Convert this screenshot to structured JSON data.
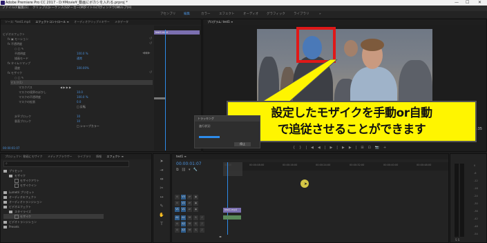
{
  "window": {
    "title": "Adobe Premiere Pro CC 2017 - D:¥Movie¥_動画にボカシを入れる.prproj *",
    "controls": [
      "—",
      "☐",
      "✕"
    ]
  },
  "menu": [
    "ファイル(F)",
    "編集(E)",
    "クリップ(C)",
    "シーケンス(S)",
    "マーカー(M)",
    "タイトル(T)",
    "ウィンドウ(W)",
    "ヘルプ(H)"
  ],
  "workspaces": {
    "items": [
      "アセンブリ",
      "編集",
      "カラー",
      "エフェクト",
      "オーディオ",
      "グラフィック",
      "ライブラリ"
    ],
    "active_index": 1,
    "more": "»"
  },
  "effect_controls": {
    "tabs": [
      "ソース: *test1.mp4",
      "エフェクトコントロール ≡",
      "オーディオクリップミキサー",
      "メタデータ"
    ],
    "clip_name": "test1.mp4",
    "rows": [
      {
        "label": "ビデオエフェクト",
        "value": "",
        "indent": 0
      },
      {
        "label": "fx ▣ モーション",
        "value": "",
        "indent": 1
      },
      {
        "label": "fx 不透明度",
        "value": "",
        "indent": 1
      },
      {
        "label": "○ □ ✎",
        "value": "",
        "indent": 2
      },
      {
        "label": "不透明度",
        "value": "100.0 %",
        "indent": 2
      },
      {
        "label": "描画モード",
        "value": "通常",
        "indent": 2
      },
      {
        "label": "fx タイムリマップ",
        "value": "",
        "indent": 1
      },
      {
        "label": "速度",
        "value": "100.00%",
        "indent": 2
      },
      {
        "label": "fx モザイク",
        "value": "",
        "indent": 1
      },
      {
        "label": "○ □ ✎",
        "value": "",
        "indent": 2
      },
      {
        "label": "マスク(1)",
        "value": "",
        "indent": 2
      },
      {
        "label": "マスクパス",
        "value": "◀ ▶ ▶ ▶",
        "indent": 3
      },
      {
        "label": "マスクの境界のぼかし",
        "value": "10.0",
        "indent": 3
      },
      {
        "label": "マスクの不透明度",
        "value": "100.0 %",
        "indent": 3
      },
      {
        "label": "マスクの拡張",
        "value": "0.0",
        "indent": 3
      },
      {
        "label": "",
        "value": "□ 反転",
        "indent": 3
      },
      {
        "label": "水平ブロック",
        "value": "10",
        "indent": 2
      },
      {
        "label": "垂直ブロック",
        "value": "10",
        "indent": 2
      },
      {
        "label": "",
        "value": "□ シャープカラー",
        "indent": 2
      }
    ],
    "timecode": "00:00:01:07"
  },
  "program_monitor": {
    "tab": "プログラム: test1 ≡",
    "timecode_right": "00:04:35",
    "transport_icons": [
      "{",
      "}",
      "|◀",
      "◀|",
      "▶",
      "|▶",
      "▶|",
      "⊞",
      "⊡",
      "📷",
      "+"
    ]
  },
  "callout": {
    "line1": "設定したモザイクを手動or自動",
    "line2": "で追従させることができます"
  },
  "dialog": {
    "title": "トラッキング",
    "message": "進行状況:",
    "button": "停止"
  },
  "project_panel": {
    "tabs": [
      "プロジェクト: 動画にモザイク",
      "メディアブラウザー",
      "ライブラリ",
      "情報",
      "エフェクト ≡"
    ],
    "search": "",
    "items": [
      {
        "label": "プリセット",
        "indent": 0
      },
      {
        "label": "モザイク",
        "indent": 1
      },
      {
        "label": "モザイクアウト",
        "indent": 2
      },
      {
        "label": "モザイクイン",
        "indent": 2
      },
      {
        "label": "Lumetri プリセット",
        "indent": 0
      },
      {
        "label": "オーディオエフェクト",
        "indent": 0
      },
      {
        "label": "オーディオトランジション",
        "indent": 0
      },
      {
        "label": "ビデオエフェクト",
        "indent": 0
      },
      {
        "label": "スタイライズ",
        "indent": 1
      },
      {
        "label": "モザイク",
        "indent": 2
      },
      {
        "label": "ビデオトランジション",
        "indent": 0
      },
      {
        "label": "Presets",
        "indent": 0
      }
    ]
  },
  "timeline": {
    "tab": "test1 ≡",
    "timecode": "00:00:01:07",
    "ruler_labels": [
      "00:00",
      "00:00:08:00",
      "00:00:16:00",
      "00:00:24:00",
      "00:00:32:00",
      "00:00:40:00",
      "00:00:48:00"
    ],
    "tracks": [
      {
        "name": "V3",
        "kind": "video"
      },
      {
        "name": "V2",
        "kind": "video"
      },
      {
        "name": "V1",
        "kind": "video"
      },
      {
        "name": "A1",
        "kind": "audio"
      },
      {
        "name": "A2",
        "kind": "audio"
      },
      {
        "name": "A3",
        "kind": "audio"
      }
    ],
    "clip_label": "test1.mp4"
  },
  "audio_meter": {
    "labels": [
      "0",
      "-6",
      "-12",
      "-18",
      "-24",
      "-30",
      "-36",
      "-42",
      "-48",
      "-54"
    ],
    "footer": "S S"
  },
  "colors": {
    "accent": "#4a8fd8",
    "callout": "#fff500",
    "box": "#e01818",
    "clip": "#7b6fb0"
  }
}
